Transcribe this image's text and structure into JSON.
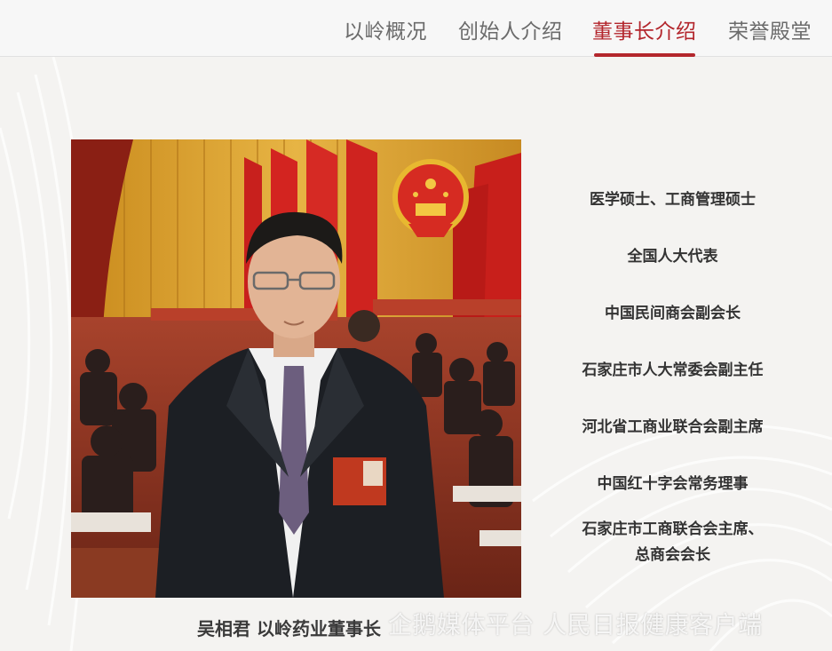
{
  "nav": {
    "tabs": [
      {
        "label": "以岭概况",
        "active": false
      },
      {
        "label": "创始人介绍",
        "active": false
      },
      {
        "label": "董事长介绍",
        "active": true
      },
      {
        "label": "荣誉殿堂",
        "active": false
      }
    ],
    "accent_color": "#b3262c"
  },
  "profile": {
    "caption": "吴相君 以岭药业董事长",
    "photo_description": "portrait-in-assembly-hall",
    "credentials": [
      "医学硕士、工商管理硕士",
      "全国人大代表",
      "中国民间商会副会长",
      "石家庄市人大常委会副主任",
      "河北省工商业联合会副主席",
      "中国红十字会常务理事",
      "石家庄市工商联合会主席、",
      "总商会会长"
    ]
  },
  "watermark": "企鹅媒体平台 人民日报健康客户端"
}
